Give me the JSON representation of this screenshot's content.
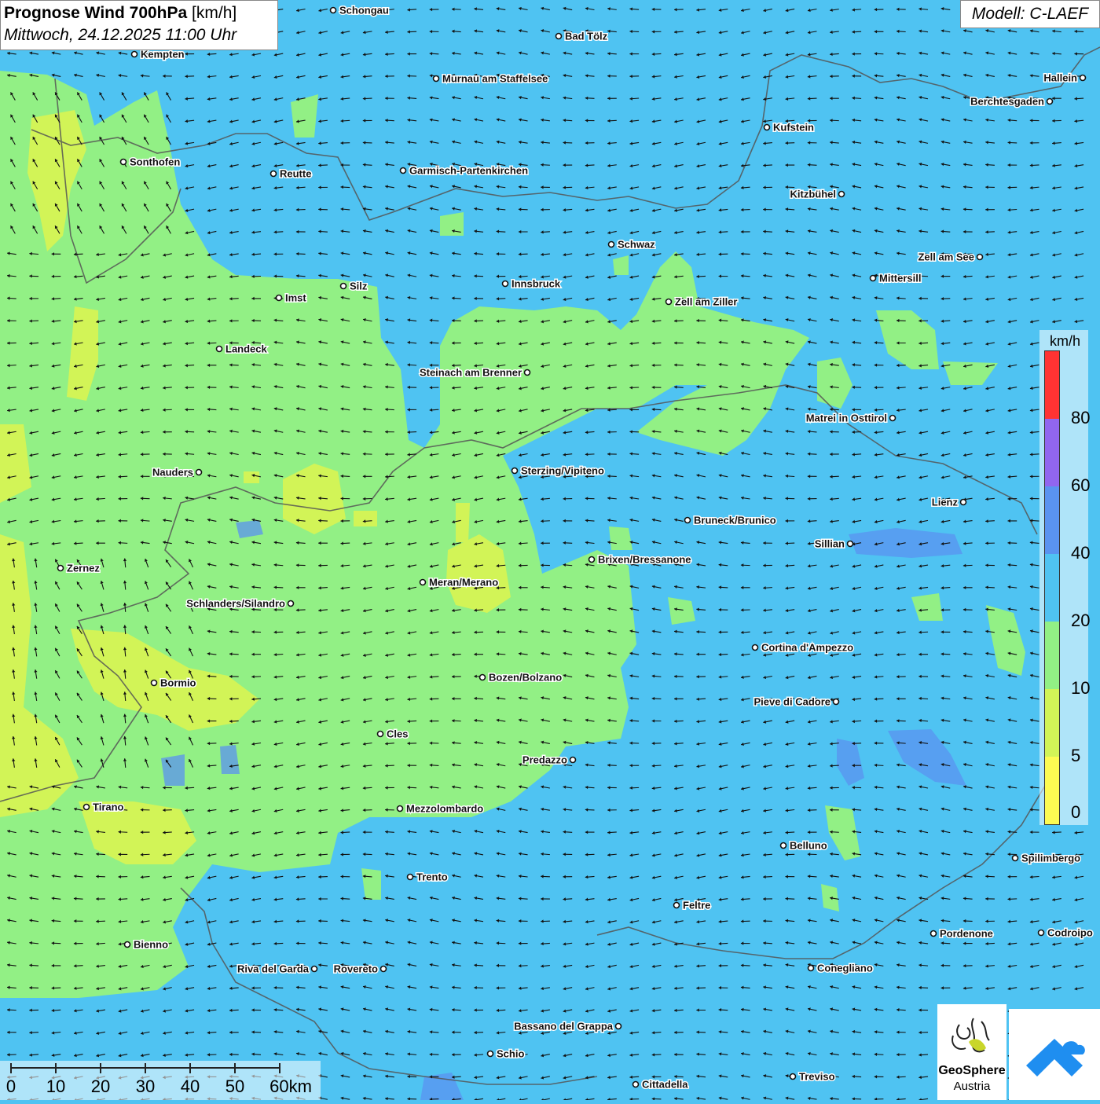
{
  "header": {
    "title_bold": "Prognose Wind 700hPa",
    "title_unit": "[km/h]",
    "subtitle": "Mittwoch, 24.12.2025 11:00 Uhr"
  },
  "model": {
    "label": "Modell: C-LAEF"
  },
  "legend": {
    "unit": "km/h",
    "ticks": [
      "0",
      "5",
      "10",
      "20",
      "40",
      "60",
      "80"
    ],
    "colors": [
      "#fdfb52",
      "#d2f457",
      "#92f085",
      "#4fc3f2",
      "#5a93f0",
      "#9166ef",
      "#ff3333"
    ]
  },
  "scale_bar": {
    "labels": [
      "0",
      "10",
      "20",
      "30",
      "40",
      "50",
      "60km"
    ]
  },
  "logos": {
    "geosphere": {
      "name": "GeoSphere",
      "sub": "Austria",
      "icon": "geosphere-logo-icon"
    },
    "app": {
      "icon": "mountain-cloud-logo-icon"
    }
  },
  "wind": {
    "dominant_direction": "east",
    "arrow_color": "#111111"
  },
  "cities": [
    {
      "name": "Schongau"
    },
    {
      "name": "Kempten"
    },
    {
      "name": "Bad Tölz"
    },
    {
      "name": "Murnau am Staffelsee"
    },
    {
      "name": "Hallein"
    },
    {
      "name": "Berchtesgaden"
    },
    {
      "name": "Kufstein"
    },
    {
      "name": "Sonthofen"
    },
    {
      "name": "Reutte"
    },
    {
      "name": "Garmisch-Partenkirchen"
    },
    {
      "name": "Kitzbühel"
    },
    {
      "name": "Schwaz"
    },
    {
      "name": "Zell am See"
    },
    {
      "name": "Mittersill"
    },
    {
      "name": "Innsbruck"
    },
    {
      "name": "Silz"
    },
    {
      "name": "Imst"
    },
    {
      "name": "Zell am Ziller"
    },
    {
      "name": "Landeck"
    },
    {
      "name": "Steinach am Brenner"
    },
    {
      "name": "Matrei in Osttirol"
    },
    {
      "name": "Nauders"
    },
    {
      "name": "Sterzing/Vipiteno"
    },
    {
      "name": "Lienz"
    },
    {
      "name": "Bruneck/Brunico"
    },
    {
      "name": "Sillian"
    },
    {
      "name": "Brixen/Bressanone"
    },
    {
      "name": "Zernez"
    },
    {
      "name": "Meran/Merano"
    },
    {
      "name": "Schlanders/Silandro"
    },
    {
      "name": "Cortina d'Ampezzo"
    },
    {
      "name": "Bozen/Bolzano"
    },
    {
      "name": "Bormio"
    },
    {
      "name": "Pieve di Cadore"
    },
    {
      "name": "Cles"
    },
    {
      "name": "Predazzo"
    },
    {
      "name": "Tirano"
    },
    {
      "name": "Mezzolombardo"
    },
    {
      "name": "Belluno"
    },
    {
      "name": "Spilimbergo"
    },
    {
      "name": "Trento"
    },
    {
      "name": "Feltre"
    },
    {
      "name": "Pordenone"
    },
    {
      "name": "Codroipo"
    },
    {
      "name": "Bienno"
    },
    {
      "name": "Riva del Garda"
    },
    {
      "name": "Rovereto"
    },
    {
      "name": "Conegliano"
    },
    {
      "name": "Bassano del Grappa"
    },
    {
      "name": "Schio"
    },
    {
      "name": "Treviso"
    },
    {
      "name": "Cittadella"
    }
  ]
}
